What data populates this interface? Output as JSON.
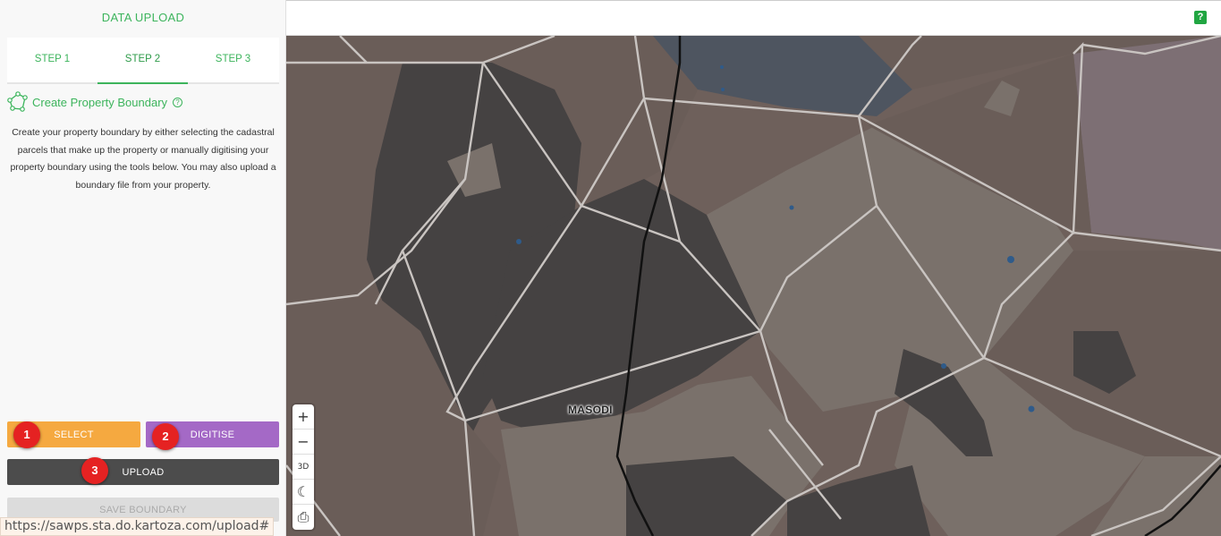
{
  "header": {
    "help_label": "?"
  },
  "sidebar": {
    "title": "DATA UPLOAD",
    "tabs": [
      {
        "label": "STEP 1"
      },
      {
        "label": "STEP 2"
      },
      {
        "label": "STEP 3"
      }
    ],
    "active_tab": "STEP 2",
    "section": {
      "title": "Create Property Boundary",
      "info_label": "?",
      "description": "Create your property boundary by either selecting the cadastral parcels that make up the property or manually digitising your property boundary using the tools below. You may also upload a boundary file from your property."
    },
    "buttons": {
      "select_label": "SELECT",
      "digitise_label": "DIGITISE",
      "upload_label": "UPLOAD",
      "save_label": "SAVE BOUNDARY"
    },
    "badges": [
      "1",
      "2",
      "3"
    ]
  },
  "map": {
    "place_label": "MASODI",
    "controls": {
      "zoom_in": "+",
      "zoom_out": "−",
      "toggle_3d": "3D",
      "dark_mode": "☾",
      "print": "⎙"
    }
  },
  "status_url": "https://sawps.sta.do.kartoza.com/upload#",
  "colors": {
    "brand_green": "#3cb45c",
    "select_orange": "#f5a940",
    "digitise_purple": "#a469c6",
    "upload_dark": "#4c4c4c",
    "badge_red": "#e52222"
  }
}
